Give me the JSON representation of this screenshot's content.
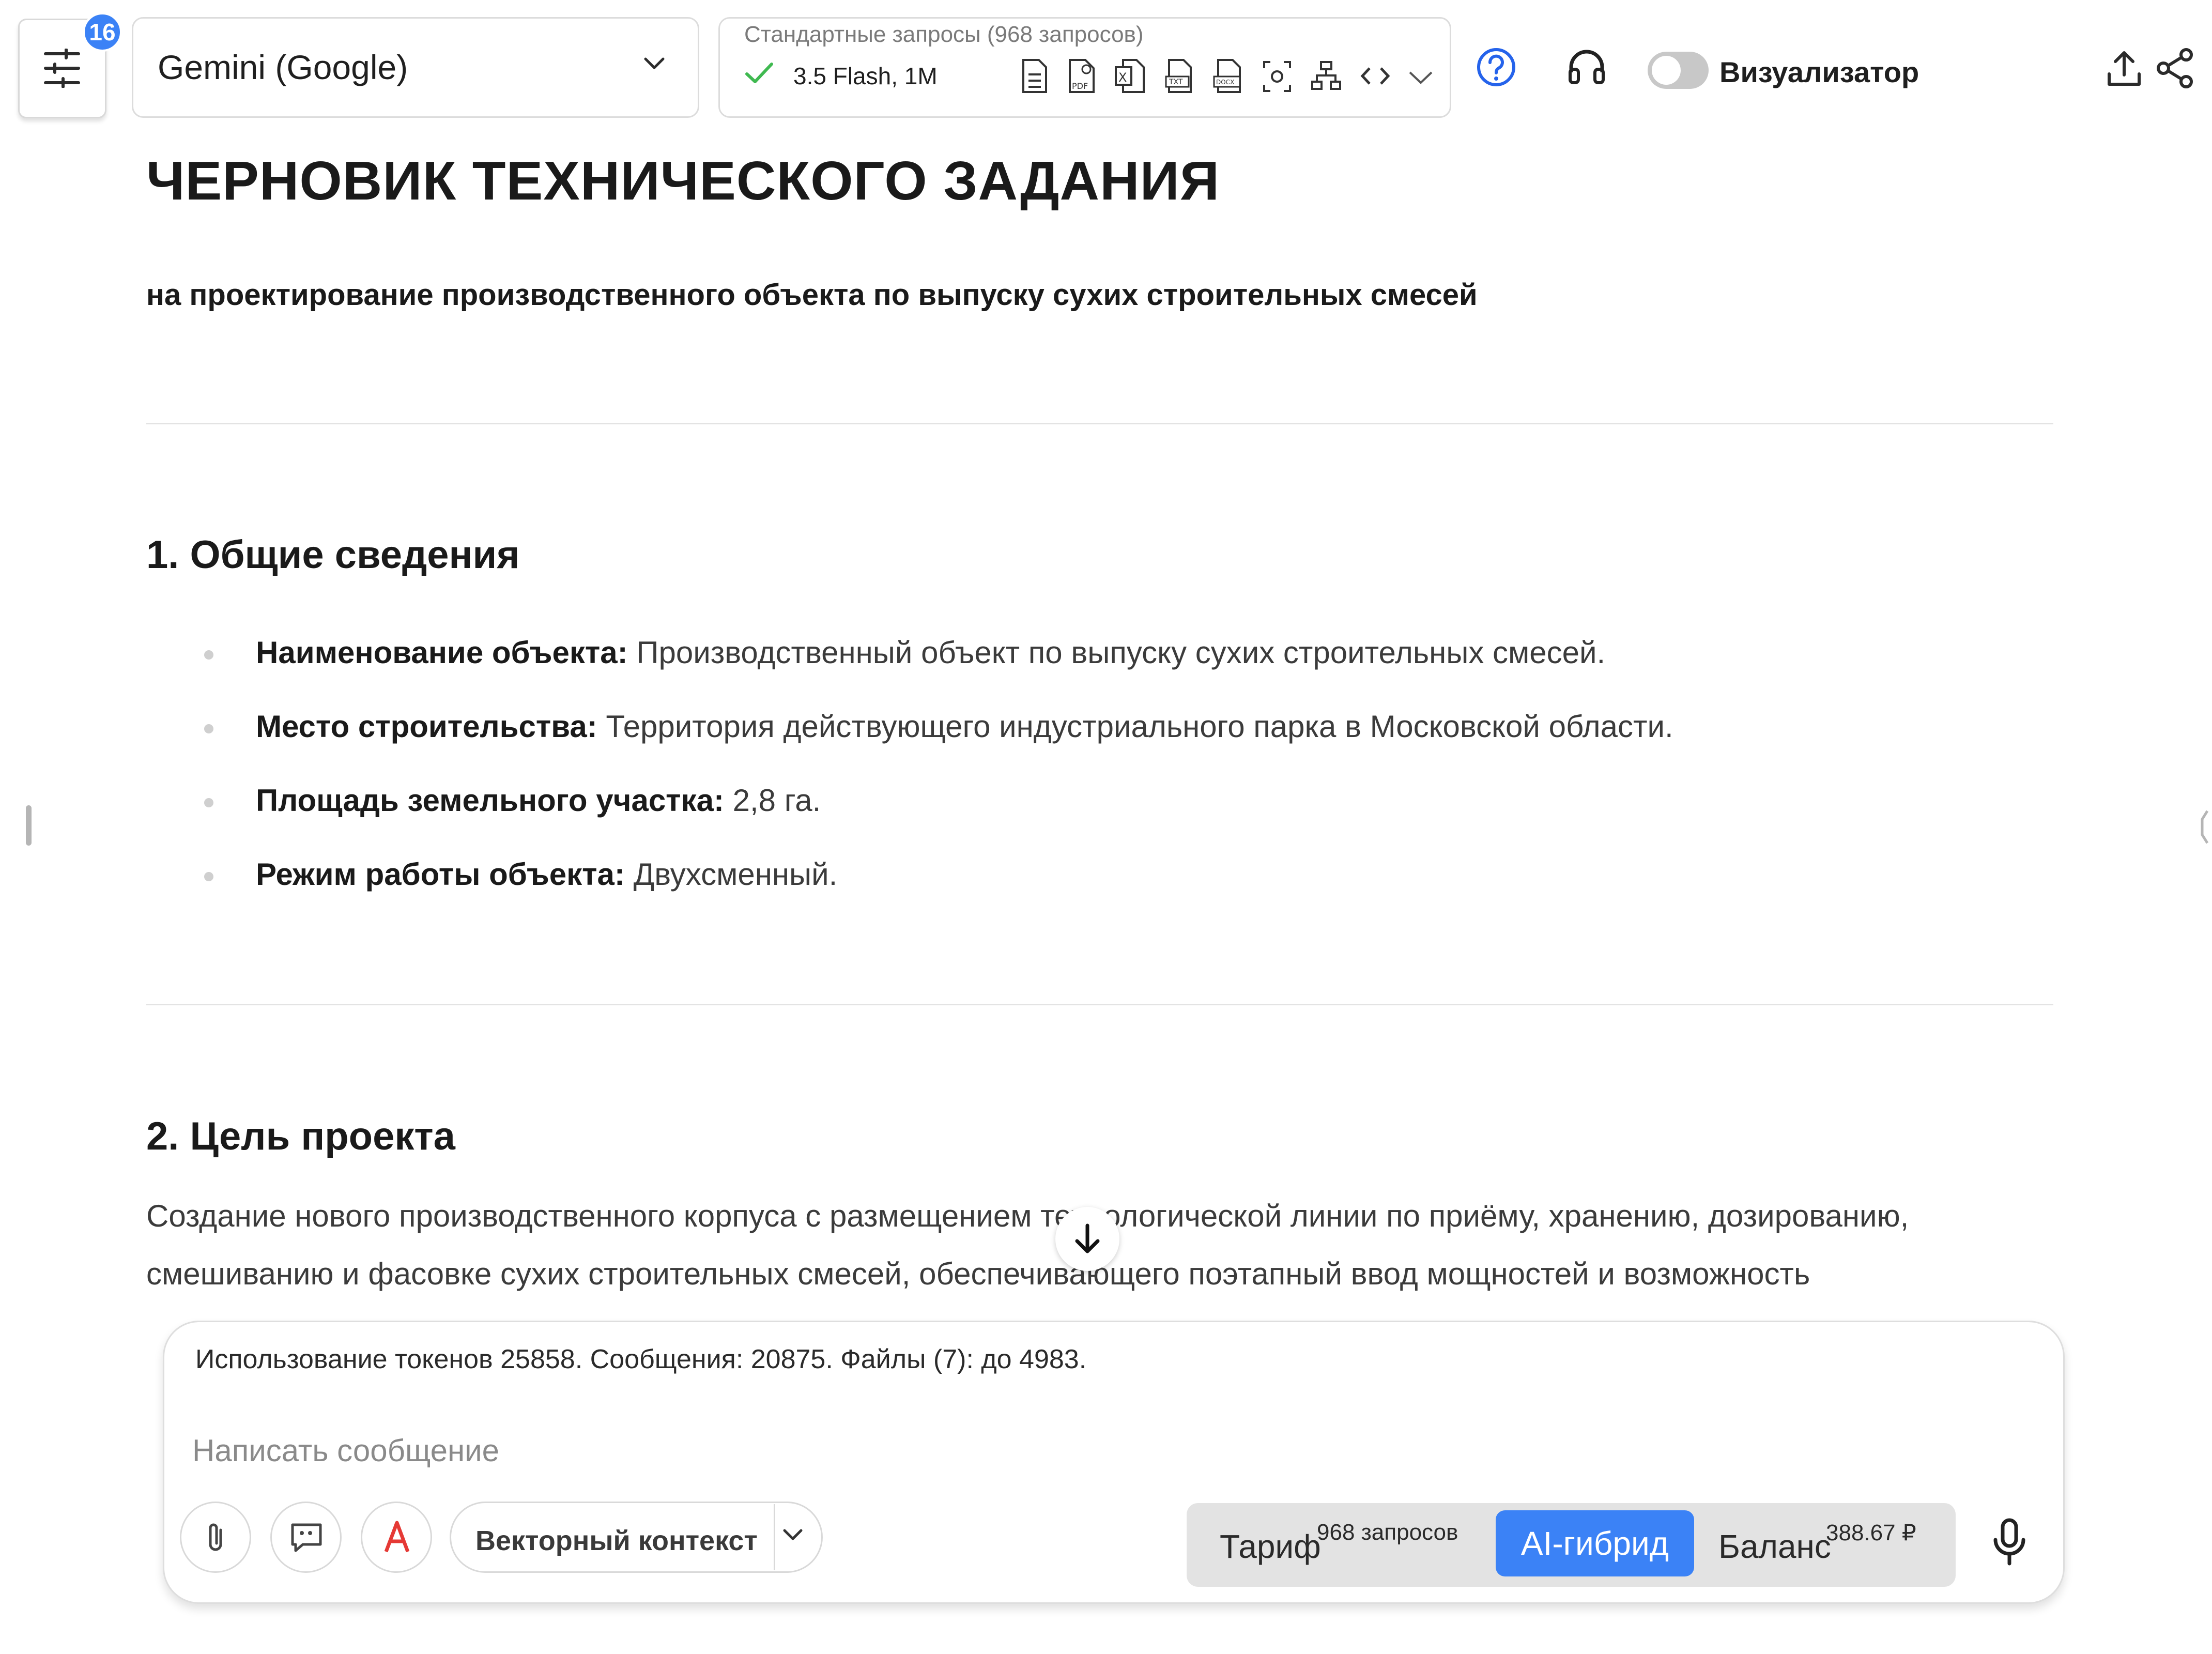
{
  "topbar": {
    "badge_count": "16",
    "model_name": "Gemini (Google)",
    "requests_title": "Стандартные запросы (968 запросов)",
    "requests_model": "3.5 Flash, 1M",
    "visualizer_label": "Визуализатор",
    "visualizer_enabled": false,
    "accent_color": "#3b82f6",
    "capability_icons": [
      "doc-icon",
      "pdf-icon",
      "excel-icon",
      "txt-icon",
      "docx-icon",
      "screenshot-icon",
      "diagram-icon",
      "code-icon"
    ]
  },
  "document": {
    "title": "ЧЕРНОВИК ТЕХНИЧЕСКОГО ЗАДАНИЯ",
    "subtitle": "на проектирование производственного объекта по выпуску сухих строительных смесей",
    "section1": {
      "heading": "1. Общие сведения",
      "items": [
        {
          "label": "Наименование объекта:",
          "value": " Производственный объект по выпуску сухих строительных смесей."
        },
        {
          "label": "Место строительства:",
          "value": " Территория действующего индустриального парка в Московской области."
        },
        {
          "label": "Площадь земельного участка:",
          "value": " 2,8 га."
        },
        {
          "label": "Режим работы объекта:",
          "value": " Двухсменный."
        }
      ]
    },
    "section2": {
      "heading": "2. Цель проекта",
      "lines": [
        "Создание нового производственного корпуса с размещением технологической линии по приёму, хранению, дозированию,",
        "смешиванию и фасовке сухих строительных смесей, обеспечивающего поэтапный ввод мощностей и возможность"
      ]
    }
  },
  "composer": {
    "usage": "Использование токенов 25858. Сообщения: 20875. Файлы (7): до 4983.",
    "placeholder": "Написать сообщение",
    "context_label": "Векторный контекст",
    "tariff_label": "Тариф",
    "tariff_value": "968 запросов",
    "ai_button": "AI-гибрид",
    "balance_label": "Баланс",
    "balance_value": "388.67 ₽"
  }
}
